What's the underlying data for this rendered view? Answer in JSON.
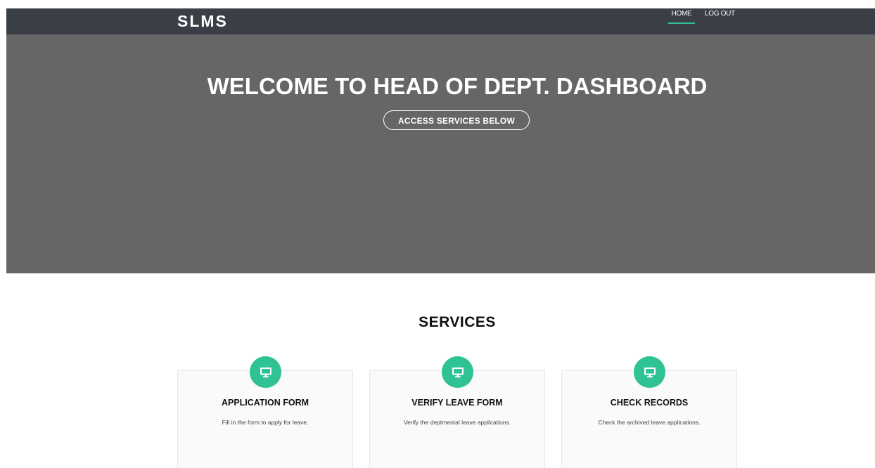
{
  "navbar": {
    "brand": "SLMS",
    "items": [
      {
        "label": "HOME",
        "active": true
      },
      {
        "label": "LOG OUT",
        "active": false
      }
    ]
  },
  "hero": {
    "title": "WELCOME TO HEAD OF DEPT. DASHBOARD",
    "button_label": "ACCESS SERVICES BELOW"
  },
  "services": {
    "title": "SERVICES",
    "cards": [
      {
        "icon": "monitor-icon",
        "title": "APPLICATION FORM",
        "text": "Fill in the form to apply for leave."
      },
      {
        "icon": "monitor-icon",
        "title": "VERIFY LEAVE FORM",
        "text": "Verify the deptmental leave applications."
      },
      {
        "icon": "monitor-icon",
        "title": "CHECK RECORDS",
        "text": "Check the archived leave applications."
      }
    ]
  },
  "colors": {
    "navbar_bg": "#3a3e46",
    "hero_bg": "#666666",
    "accent": "#2fc295"
  }
}
